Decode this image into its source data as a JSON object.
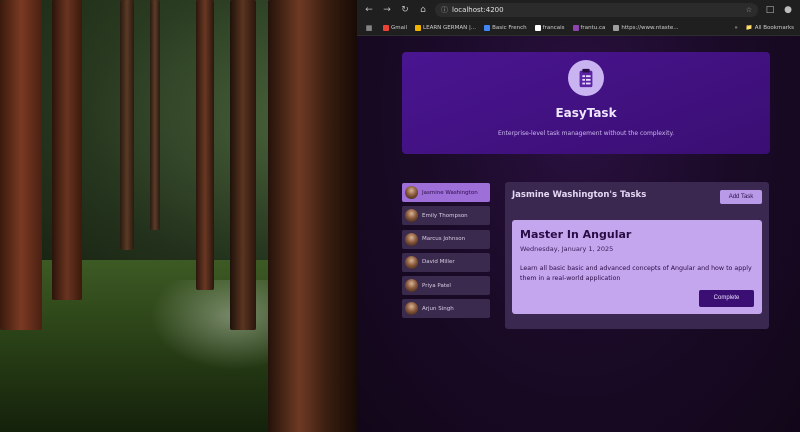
{
  "browser": {
    "url": "localhost:4200",
    "bookmarks": [
      {
        "label": "Gmail",
        "color": "#ea4335"
      },
      {
        "label": "LEARN GERMAN |...",
        "color": "#f0b400"
      },
      {
        "label": "Basic French",
        "color": "#4285f4"
      },
      {
        "label": "francais",
        "color": "#ffffff"
      },
      {
        "label": "frantu.ca",
        "color": "#8e44ad"
      },
      {
        "label": "https://www.ntaste...",
        "color": "#9e9e9e"
      }
    ],
    "all_bookmarks": "All Bookmarks"
  },
  "header": {
    "title": "EasyTask",
    "subtitle": "Enterprise-level task management without the complexity."
  },
  "users": [
    {
      "name": "Jasmine Washington",
      "active": true
    },
    {
      "name": "Emily Thompson",
      "active": false
    },
    {
      "name": "Marcus Johnson",
      "active": false
    },
    {
      "name": "David Miller",
      "active": false
    },
    {
      "name": "Priya Patel",
      "active": false
    },
    {
      "name": "Arjun Singh",
      "active": false
    }
  ],
  "tasks": {
    "title": "Jasmine Washington's Tasks",
    "add_label": "Add Task",
    "items": [
      {
        "title": "Master In Angular",
        "date": "Wednesday, January 1, 2025",
        "description": "Learn all basic basic and advanced concepts of Angular and how to apply them in a real-world application",
        "complete_label": "Complete"
      }
    ]
  },
  "colors": {
    "accent": "#3a0e73",
    "header_bg": "#4a1591",
    "active_user": "#9e6fd8",
    "task_card": "#c4a6ee"
  }
}
